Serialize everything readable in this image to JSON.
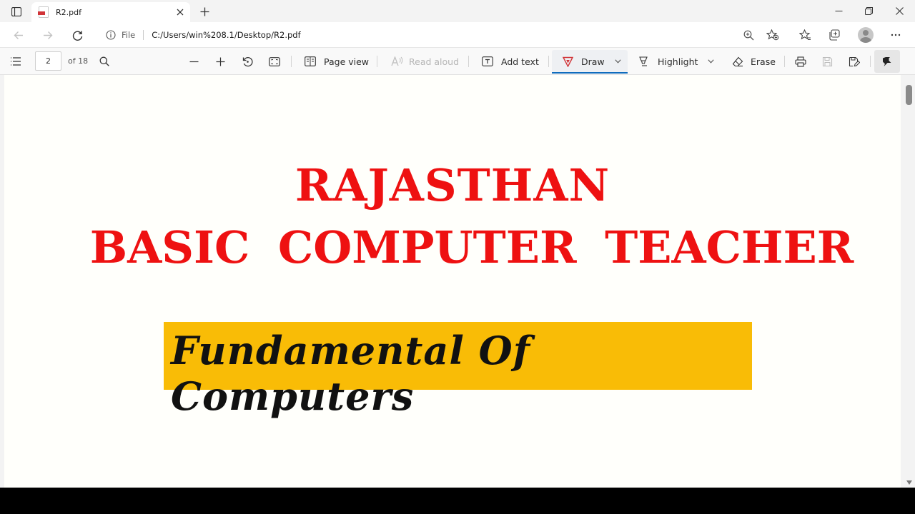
{
  "browser": {
    "tab": {
      "title": "R2.pdf"
    },
    "address": {
      "scheme_label": "File",
      "url": "C:/Users/win%208.1/Desktop/R2.pdf"
    }
  },
  "pdf_toolbar": {
    "current_page": "2",
    "total_pages": "of 18",
    "page_view_label": "Page view",
    "read_aloud_label": "Read aloud",
    "add_text_label": "Add text",
    "draw_label": "Draw",
    "highlight_label": "Highlight",
    "erase_label": "Erase",
    "accent_color": "#0f6cbd",
    "draw_pen_color": "#d13438"
  },
  "document": {
    "title_line1": "RAJASTHAN",
    "title_line2": "BASIC COMPUTER TEACHER",
    "subject": "Fundamental Of Computers",
    "title_color": "#ee1111",
    "subject_bg_color": "#f9bc06"
  }
}
